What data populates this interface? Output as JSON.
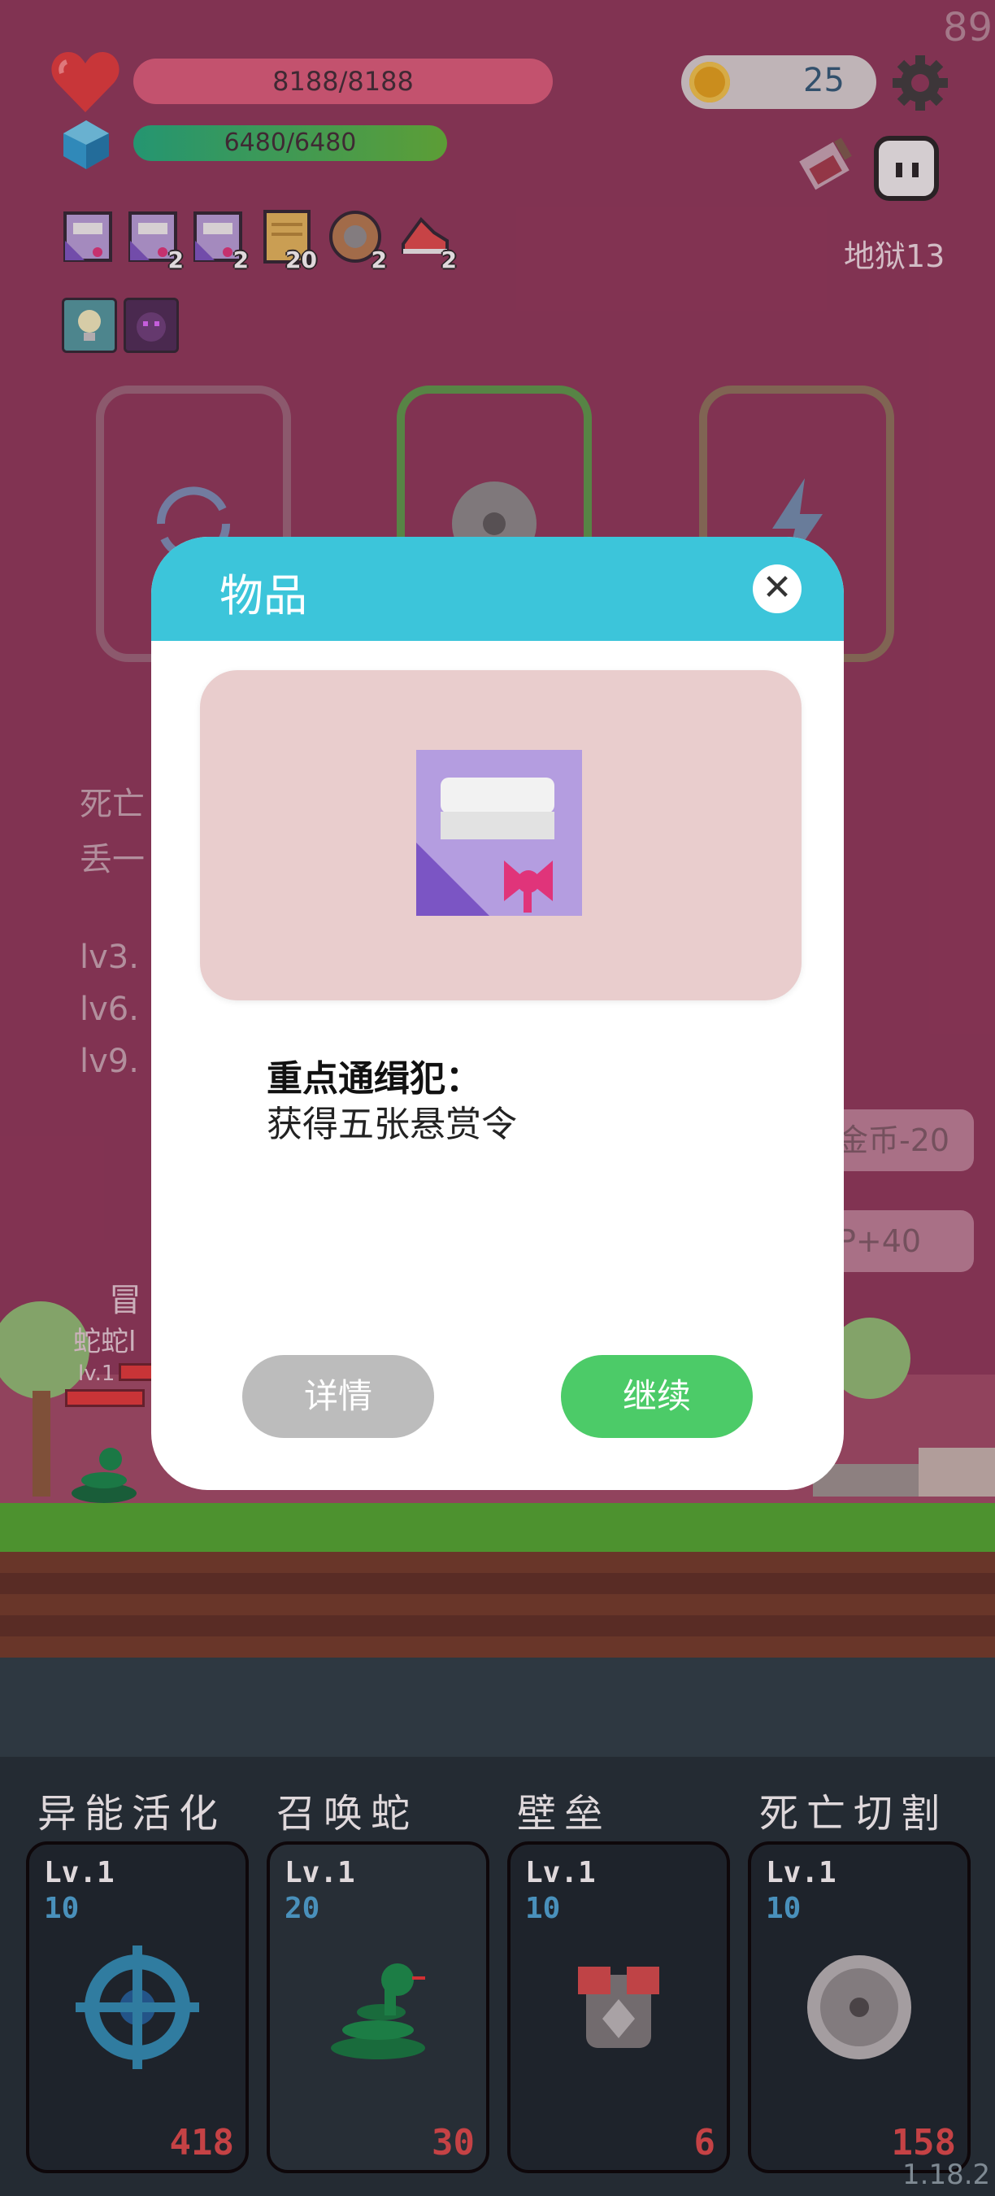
{
  "hud": {
    "hp_text": "8188/8188",
    "mp_text": "6480/6480",
    "coins": "25",
    "corner_number": "89",
    "hell_level": "地狱13",
    "buffs": [
      {
        "icon": "gift-scroll-icon",
        "count": ""
      },
      {
        "icon": "gift-scroll-icon",
        "count": "2"
      },
      {
        "icon": "gift-scroll-icon",
        "count": "2"
      },
      {
        "icon": "map-scroll-icon",
        "count": "20"
      },
      {
        "icon": "shield-icon",
        "count": "2"
      },
      {
        "icon": "sneaker-icon",
        "count": "2"
      }
    ]
  },
  "background": {
    "line1": "死亡",
    "line2": "丢一",
    "line3": "lv3.",
    "line4": "lv6.",
    "line5": "lv9.",
    "side_btn1": "金币-20",
    "side_btn2": "P+40",
    "label_adventure": "冒",
    "label_snake": "蛇蛇l",
    "label_lv": "lv.1"
  },
  "modal": {
    "title": "物品",
    "item_name": "重点通缉犯：",
    "item_desc": "获得五张悬赏令",
    "detail_btn": "详情",
    "continue_btn": "继续"
  },
  "skills": [
    {
      "name": "异能活化",
      "lv": "Lv.1",
      "cost": "10",
      "count": "418",
      "icon": "crosshair-icon"
    },
    {
      "name": "召唤蛇",
      "lv": "Lv.1",
      "cost": "20",
      "count": "30",
      "icon": "snake-icon"
    },
    {
      "name": "壁垒",
      "lv": "Lv.1",
      "cost": "10",
      "count": "6",
      "icon": "armor-icon"
    },
    {
      "name": "死亡切割",
      "lv": "Lv.1",
      "cost": "10",
      "count": "158",
      "icon": "saw-blade-icon"
    }
  ],
  "version": "1.18.2",
  "colors": {
    "background": "#8d3658",
    "modal_header": "#3cc5da",
    "continue": "#4ccb68",
    "detail": "#bcbcbc"
  }
}
